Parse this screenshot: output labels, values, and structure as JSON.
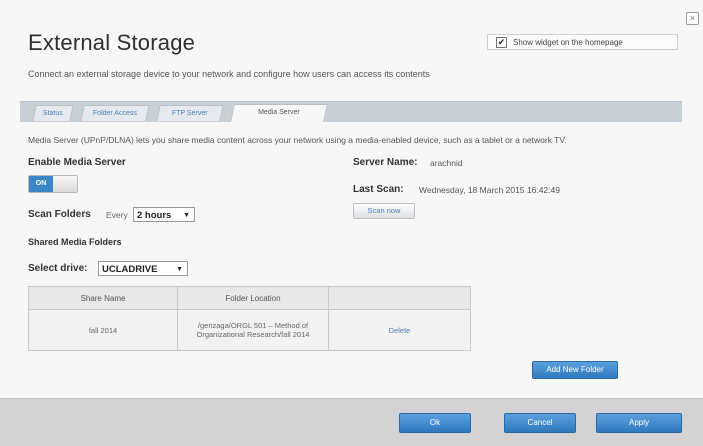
{
  "header": {
    "title": "External Storage",
    "subtitle": "Connect an external storage device to your network and configure how users can access its contents",
    "widget_label": "Show widget on the homepage",
    "widget_checked": true,
    "close_glyph": "×"
  },
  "tabs": [
    {
      "label": "Status",
      "active": false
    },
    {
      "label": "Folder Access",
      "active": false
    },
    {
      "label": "FTP Server",
      "active": false
    },
    {
      "label": "Media Server",
      "active": true
    }
  ],
  "main": {
    "description": "Media Server (UPnP/DLNA) lets you share media content across your network using a media-enabled device, such as a tablet or a network TV.",
    "enable_label": "Enable Media Server",
    "toggle_state": "ON",
    "scan_folders_label": "Scan Folders",
    "scan_every_label": "Every",
    "scan_interval": "2 hours",
    "shared_media_label": "Shared Media Folders",
    "select_drive_label": "Select drive:",
    "drive": "UCLADRIVE",
    "server_name_label": "Server Name:",
    "server_name": "arachnid",
    "last_scan_label": "Last Scan:",
    "last_scan": "Wednesday, 18 March 2015 16:42:49",
    "scan_now_label": "Scan now"
  },
  "table": {
    "headers": [
      "Share Name",
      "Folder Location",
      ""
    ],
    "rows": [
      {
        "share_name": "fall 2014",
        "folder_location": "/genzaga/ORGL 501 – Method of Organizational Research/fall 2014",
        "action": "Delete"
      }
    ]
  },
  "add_folder_label": "Add New Folder",
  "footer": {
    "ok": "Ok",
    "cancel": "Cancel",
    "apply": "Apply"
  },
  "colors": {
    "accent": "#3a86c8",
    "link": "#4a80b8",
    "tabstrip": "#c9d0d6"
  }
}
